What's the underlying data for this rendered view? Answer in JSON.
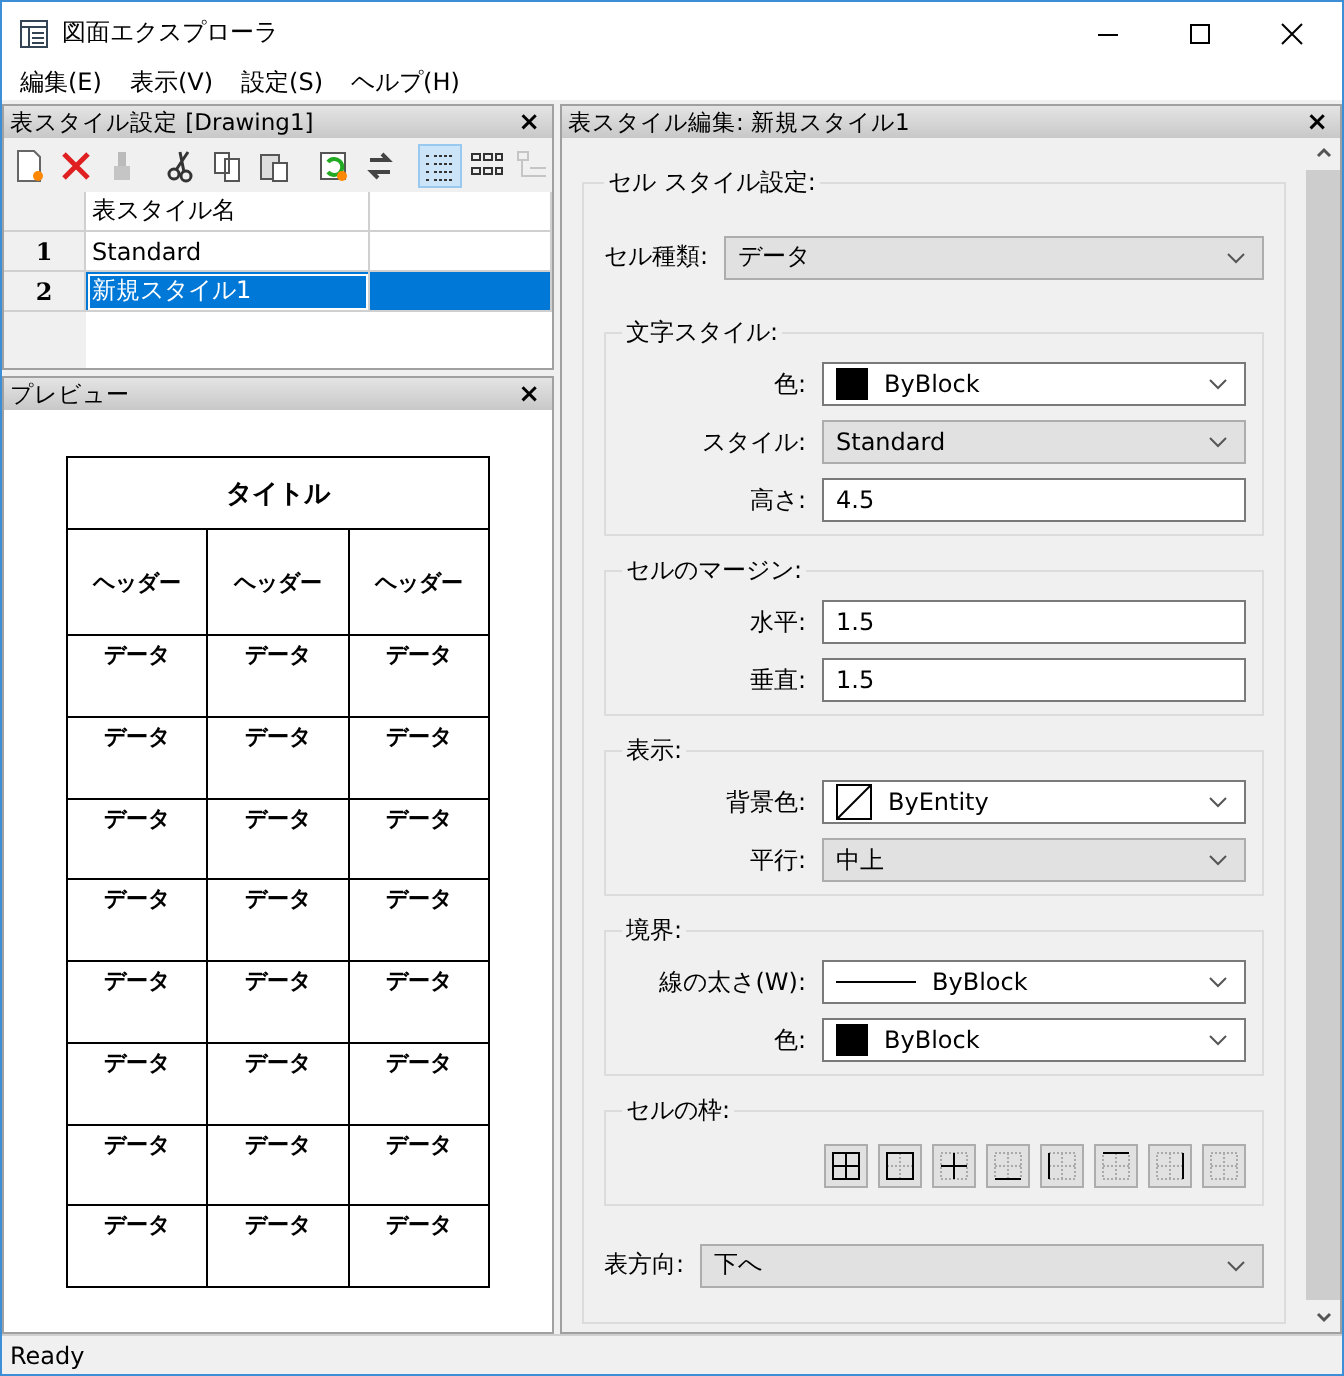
{
  "window": {
    "title": "図面エクスプローラ"
  },
  "menu": [
    "編集(E)",
    "表示(V)",
    "設定(S)",
    "ヘルプ(H)"
  ],
  "style_panel": {
    "title": "表スタイル設定 [Drawing1]",
    "close": "×",
    "toolbar": [
      {
        "kind": "new",
        "disabled": false,
        "selected": false
      },
      {
        "kind": "delete",
        "disabled": false,
        "selected": false
      },
      {
        "kind": "brush",
        "disabled": true,
        "selected": false
      },
      {
        "kind": "sep"
      },
      {
        "kind": "cut",
        "disabled": false,
        "selected": false
      },
      {
        "kind": "copy",
        "disabled": false,
        "selected": false
      },
      {
        "kind": "paste",
        "disabled": false,
        "selected": false
      },
      {
        "kind": "sep"
      },
      {
        "kind": "import",
        "disabled": false,
        "selected": false
      },
      {
        "kind": "swap",
        "disabled": false,
        "selected": false
      },
      {
        "kind": "sep"
      },
      {
        "kind": "list",
        "disabled": false,
        "selected": true
      },
      {
        "kind": "grid",
        "disabled": false,
        "selected": false
      },
      {
        "kind": "tree",
        "disabled": true,
        "selected": false
      }
    ],
    "column": "表スタイル名",
    "rows": [
      {
        "num": "1",
        "name": "Standard",
        "selected": false
      },
      {
        "num": "2",
        "name": "新規スタイル1",
        "selected": true
      }
    ]
  },
  "preview": {
    "title": "プレビュー",
    "close": "×",
    "table_title": "タイトル",
    "headers": [
      "ヘッダー",
      "ヘッダー",
      "ヘッダー"
    ],
    "rows": [
      [
        "データ",
        "データ",
        "データ"
      ],
      [
        "データ",
        "データ",
        "データ"
      ],
      [
        "データ",
        "データ",
        "データ"
      ],
      [
        "データ",
        "データ",
        "データ"
      ],
      [
        "データ",
        "データ",
        "データ"
      ],
      [
        "データ",
        "データ",
        "データ"
      ],
      [
        "データ",
        "データ",
        "データ"
      ],
      [
        "データ",
        "データ",
        "データ"
      ]
    ]
  },
  "editor": {
    "title": "表スタイル編集: 新規スタイル1",
    "close": "×",
    "section": "セル スタイル設定:",
    "cell_type": {
      "label": "セル種類:",
      "kind": "select",
      "value": "データ"
    },
    "groups": [
      {
        "title": "文字スタイル:",
        "fields": [
          {
            "label": "色:",
            "kind": "color",
            "color": "#000000",
            "value": "ByBlock"
          },
          {
            "label": "スタイル:",
            "kind": "select",
            "value": "Standard"
          },
          {
            "label": "高さ:",
            "kind": "text",
            "value": "4.5"
          }
        ]
      },
      {
        "title": "セルのマージン:",
        "fields": [
          {
            "label": "水平:",
            "kind": "text",
            "value": "1.5"
          },
          {
            "label": "垂直:",
            "kind": "text",
            "value": "1.5"
          }
        ]
      },
      {
        "title": "表示:",
        "fields": [
          {
            "label": "背景色:",
            "kind": "entity",
            "value": "ByEntity"
          },
          {
            "label": "平行:",
            "kind": "select",
            "value": "中上"
          }
        ]
      },
      {
        "title": "境界:",
        "fields": [
          {
            "label": "線の太さ(W):",
            "kind": "line",
            "value": "ByBlock"
          },
          {
            "label": "色:",
            "kind": "color",
            "color": "#000000",
            "value": "ByBlock"
          }
        ]
      }
    ],
    "cell_border": {
      "title": "セルの枠:",
      "buttons": [
        {
          "kind": "all"
        },
        {
          "kind": "outer"
        },
        {
          "kind": "inner"
        },
        {
          "kind": "bottom"
        },
        {
          "kind": "left"
        },
        {
          "kind": "top"
        },
        {
          "kind": "right"
        },
        {
          "kind": "none"
        }
      ]
    },
    "direction": {
      "label": "表方向:",
      "kind": "select",
      "value": "下へ"
    }
  },
  "status_bar": "Ready"
}
